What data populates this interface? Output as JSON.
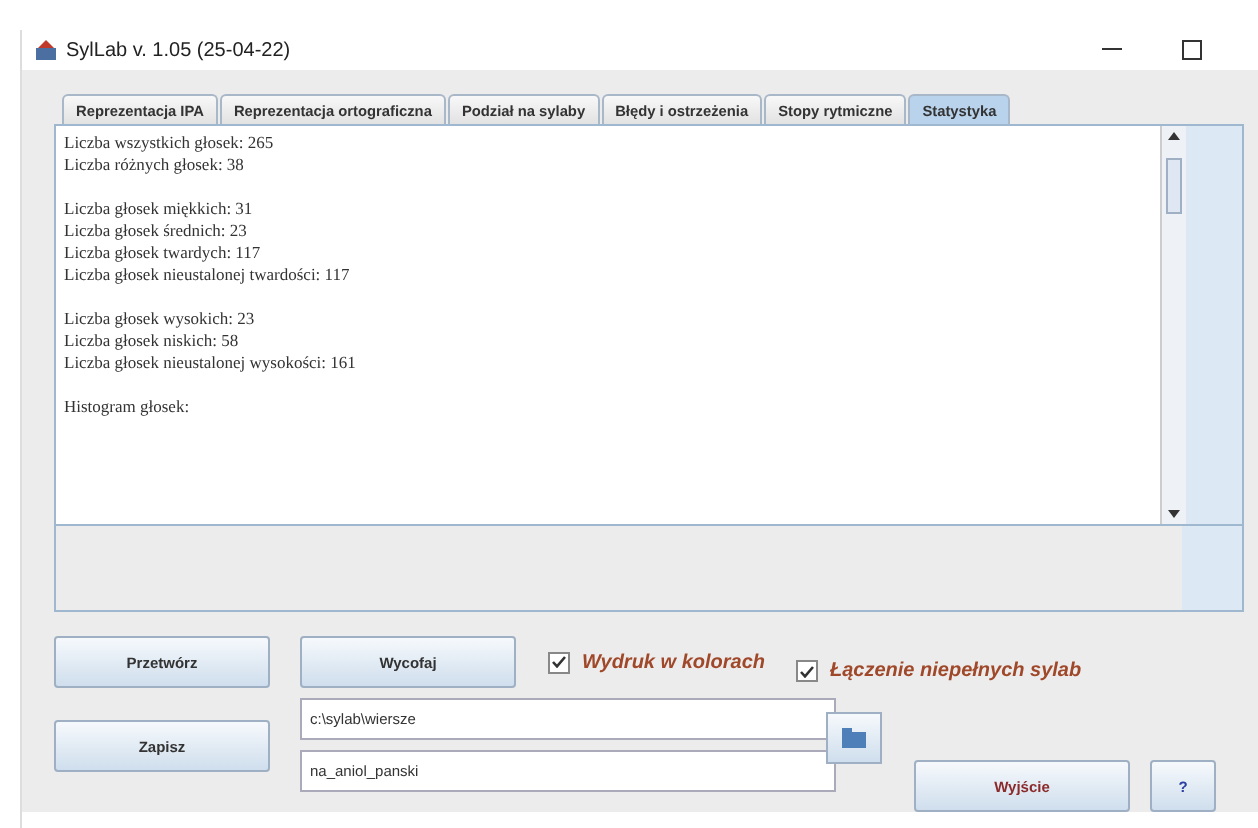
{
  "window": {
    "title": "SylLab v. 1.05 (25-04-22)"
  },
  "tabs": [
    {
      "label": "Reprezentacja IPA",
      "selected": false
    },
    {
      "label": "Reprezentacja ortograficzna",
      "selected": false
    },
    {
      "label": "Podział na sylaby",
      "selected": false
    },
    {
      "label": "Błędy i ostrzeżenia",
      "selected": false
    },
    {
      "label": "Stopy rytmiczne",
      "selected": false
    },
    {
      "label": "Statystyka",
      "selected": true
    }
  ],
  "statistics_groups": [
    [
      "Liczba wszystkich głosek: 265",
      "Liczba różnych głosek: 38"
    ],
    [
      "Liczba głosek miękkich: 31",
      "Liczba głosek średnich: 23",
      "Liczba głosek twardych: 117",
      "Liczba głosek nieustalonej twardości: 117"
    ],
    [
      "Liczba głosek wysokich: 23",
      "Liczba głosek niskich: 58",
      "Liczba głosek nieustalonej wysokości: 161"
    ],
    [
      "Histogram głosek:"
    ]
  ],
  "buttons": {
    "process": "Przetwórz",
    "undo": "Wycofaj",
    "save": "Zapisz",
    "exit": "Wyjście",
    "help": "?"
  },
  "options": [
    {
      "label": "Wydruk w kolorach",
      "checked": true
    },
    {
      "label": "Łączenie niepełnych sylab",
      "checked": true
    }
  ],
  "fields": [
    {
      "value": "c:\\sylab\\wiersze"
    },
    {
      "value": "na_aniol_panski"
    }
  ]
}
